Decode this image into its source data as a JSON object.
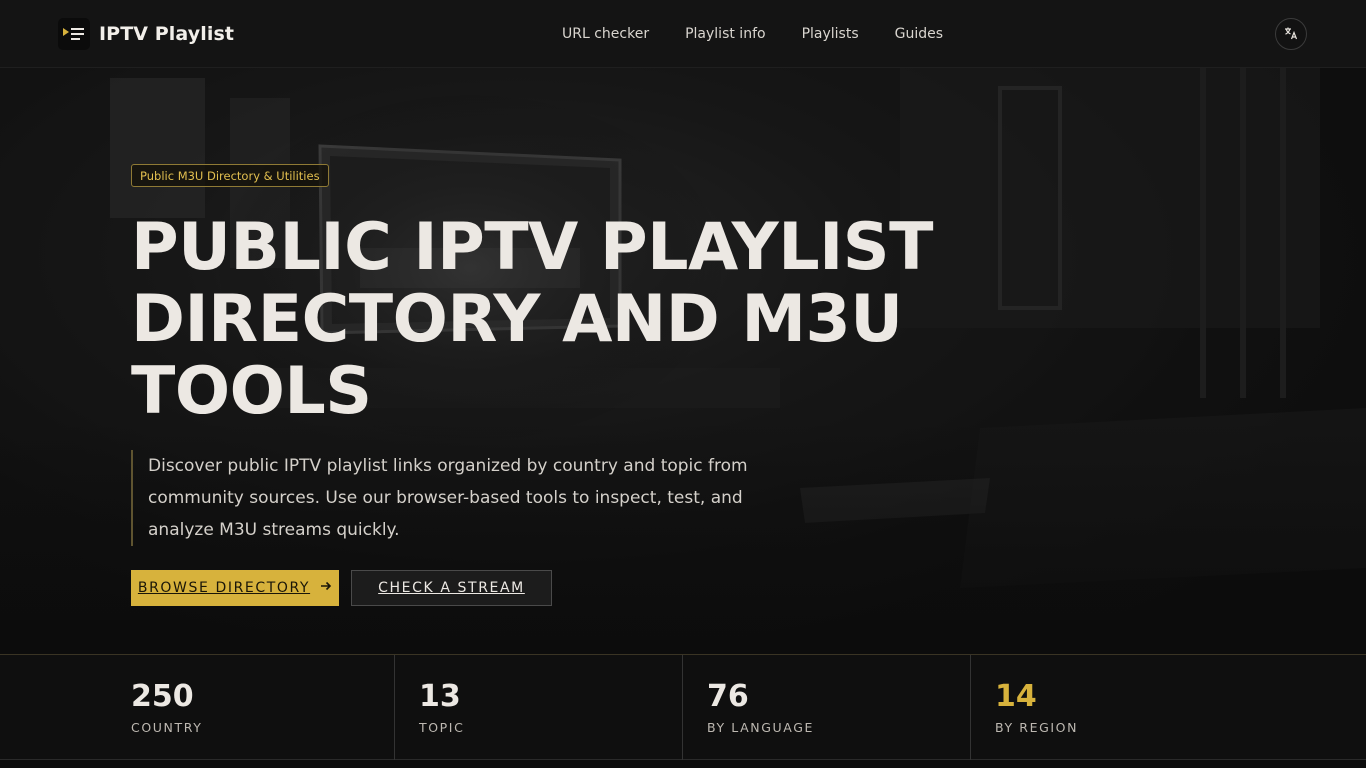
{
  "header": {
    "brand_name": "IPTV Playlist",
    "logo_icon": "play-list-icon",
    "nav": [
      {
        "label": "URL checker"
      },
      {
        "label": "Playlist info"
      },
      {
        "label": "Playlists"
      },
      {
        "label": "Guides"
      }
    ],
    "language_icon": "translate-icon"
  },
  "hero": {
    "badge": "Public M3U Directory & Utilities",
    "title_lines": [
      "PUBLIC IPTV PLAYLIST",
      "DIRECTORY AND M3U",
      "TOOLS"
    ],
    "description": "Discover public IPTV playlist links organized by country and topic from community sources. Use our browser-based tools to inspect, test, and analyze M3U streams quickly.",
    "primary_button": "BROWSE DIRECTORY",
    "primary_button_icon": "arrow-right-icon",
    "secondary_button": "CHECK A STREAM"
  },
  "stats": [
    {
      "value": "250",
      "label": "COUNTRY"
    },
    {
      "value": "13",
      "label": "TOPIC"
    },
    {
      "value": "76",
      "label": "BY LANGUAGE"
    },
    {
      "value": "14",
      "label": "BY REGION"
    }
  ],
  "colors": {
    "accent": "#d7b23c",
    "background": "#0c0c0c",
    "header_background": "#141414",
    "text_primary": "#ece8e3"
  }
}
